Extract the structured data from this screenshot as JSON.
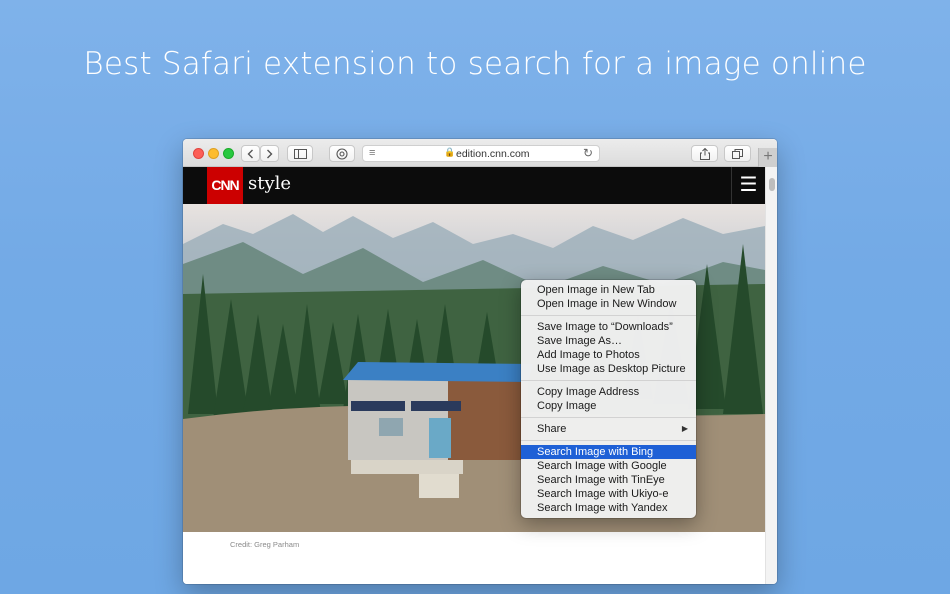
{
  "headline": "Best Safari extension to search for a image online",
  "browser": {
    "url": "edition.cnn.com",
    "newtab_label": "+"
  },
  "site": {
    "logo_text": "CNN",
    "section": "style",
    "credit": "Credit: Greg Parham"
  },
  "context_menu": {
    "groups": [
      [
        "Open Image in New Tab",
        "Open Image in New Window"
      ],
      [
        "Save Image to “Downloads”",
        "Save Image As…",
        "Add Image to Photos",
        "Use Image as Desktop Picture"
      ],
      [
        "Copy Image Address",
        "Copy Image"
      ],
      [
        "Share"
      ],
      [
        "Search Image with Bing",
        "Search Image with Google",
        "Search Image with TinEye",
        "Search Image with Ukiyo-e",
        "Search Image with Yandex"
      ]
    ],
    "highlighted": "Search Image with Bing"
  },
  "colors": {
    "background": "#73aae6",
    "highlight": "#1e60d6",
    "cnn_red": "#cc0000"
  }
}
